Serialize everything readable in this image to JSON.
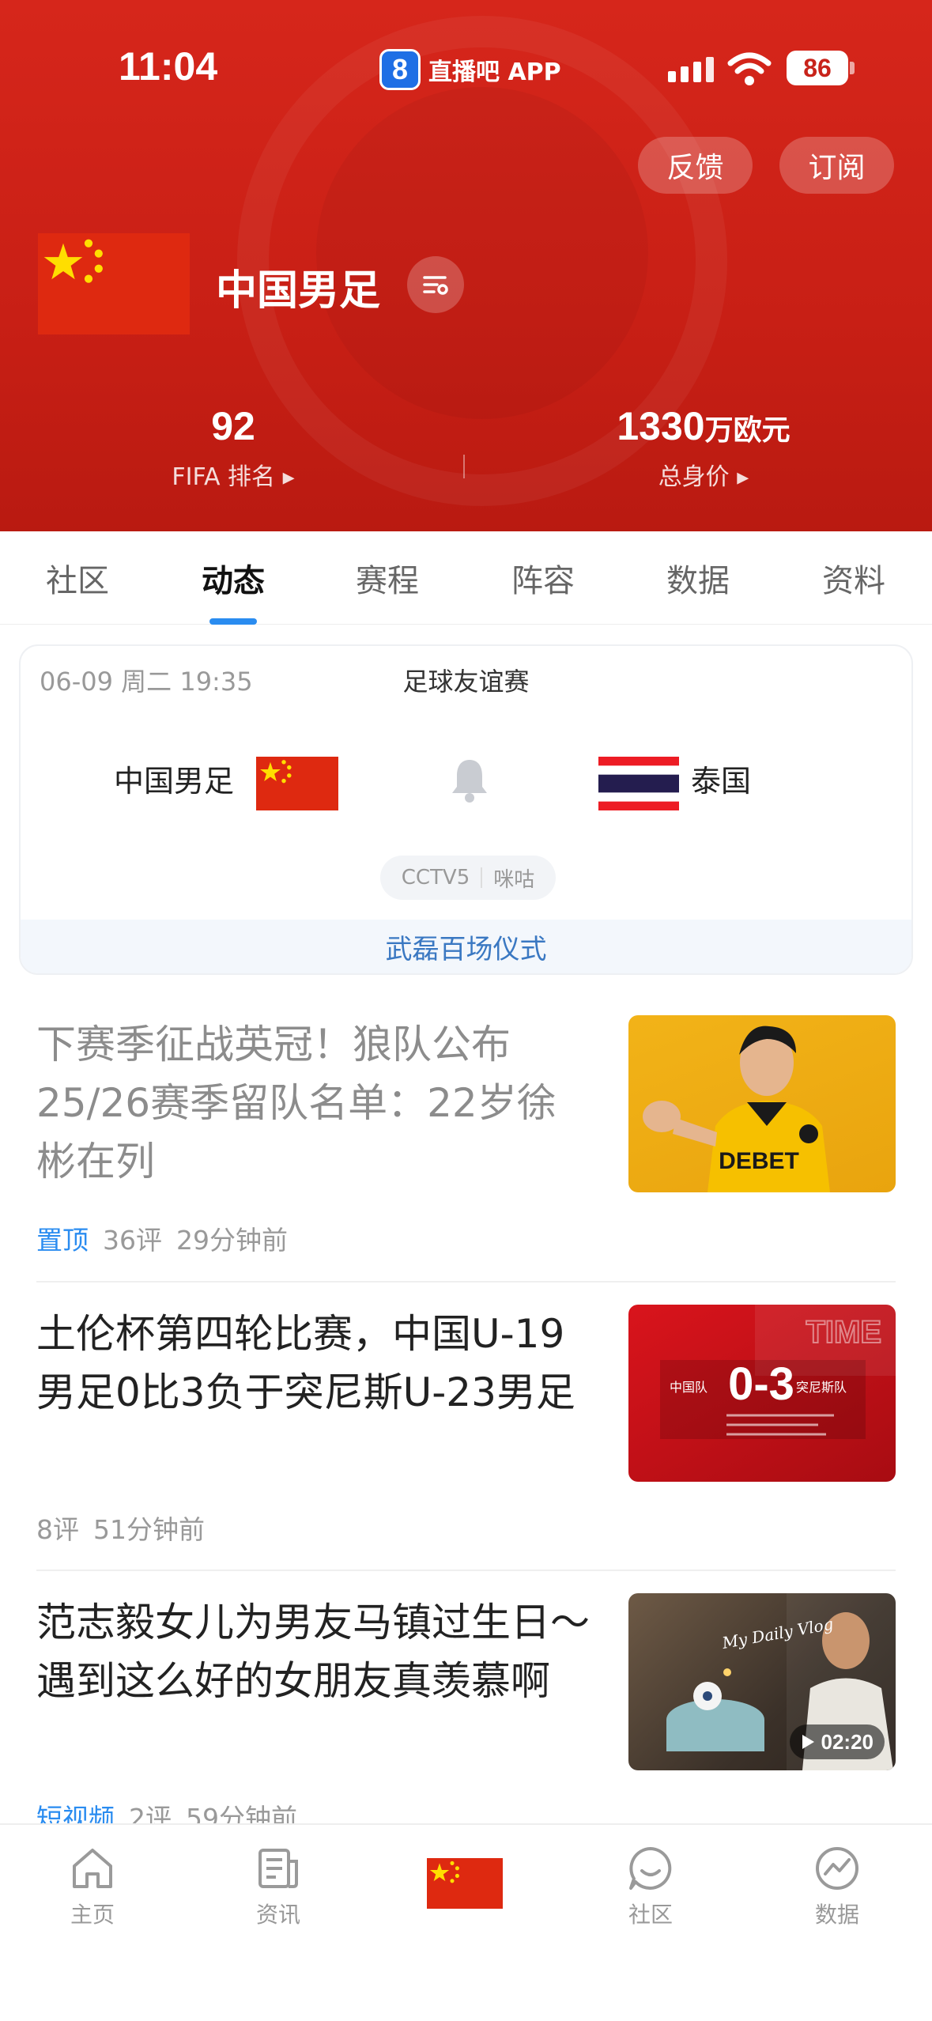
{
  "status_bar": {
    "time": "11:04",
    "app_badge": "8",
    "app_name": "直播吧 APP",
    "battery": "86"
  },
  "header": {
    "feedback_label": "反馈",
    "subscribe_label": "订阅",
    "team_name": "中国男足",
    "stats": [
      {
        "value": "92",
        "unit": "",
        "label": "FIFA 排名"
      },
      {
        "value": "1330",
        "unit": "万欧元",
        "label": "总身价"
      }
    ],
    "colors": {
      "primary": "#c8231a"
    }
  },
  "tabs": [
    {
      "label": "社区",
      "active": false
    },
    {
      "label": "动态",
      "active": true
    },
    {
      "label": "赛程",
      "active": false
    },
    {
      "label": "阵容",
      "active": false
    },
    {
      "label": "数据",
      "active": false
    },
    {
      "label": "资料",
      "active": false
    }
  ],
  "match": {
    "datetime": "06-09 周二 19:35",
    "competition": "足球友谊赛",
    "home_team": "中国男足",
    "away_team": "泰国",
    "broadcasters": [
      "CCTV5",
      "咪咕"
    ],
    "footer": "武磊百场仪式"
  },
  "news": [
    {
      "title": "下赛季征战英冠！狼队公布25/26赛季留队名单：22岁徐彬在列",
      "tag": "置顶",
      "comments": "36评",
      "time": "29分钟前",
      "image_text": "DEBET"
    },
    {
      "title": "土伦杯第四轮比赛，中国U-19男足0比3负于突尼斯U-23男足",
      "tag": "",
      "comments": "8评",
      "time": "51分钟前",
      "image_text": {
        "home": "中国队",
        "score": "0-3",
        "away": "突尼斯队",
        "banner": "TIME"
      }
    },
    {
      "title": "范志毅女儿为男友马镇过生日～遇到这么好的女朋友真羡慕啊",
      "tag": "短视频",
      "comments": "2评",
      "time": "59分钟前",
      "image_text": "My Daily Vlog",
      "duration": "02:20"
    }
  ],
  "bottom_nav": [
    {
      "label": "主页",
      "icon": "home-icon"
    },
    {
      "label": "资讯",
      "icon": "news-icon"
    },
    {
      "label": "",
      "icon": "china-flag-icon"
    },
    {
      "label": "社区",
      "icon": "community-icon"
    },
    {
      "label": "数据",
      "icon": "data-icon"
    }
  ]
}
